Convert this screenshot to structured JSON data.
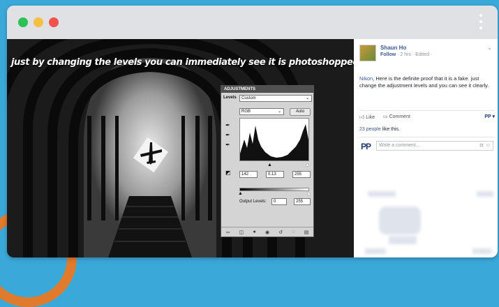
{
  "window": {
    "controls": [
      "close-dot",
      "minimize-dot",
      "maximize-dot"
    ],
    "colors": {
      "green": "#2bc157",
      "yellow": "#f5c042",
      "red": "#f2544c",
      "titlebar": "#dfe1e5"
    }
  },
  "photo": {
    "caption": "just by changing the levels you can immediately see it is photoshopped"
  },
  "adjustments": {
    "title": "ADJUSTMENTS",
    "preset_label": "Levels",
    "preset_value": "Custom",
    "channel": "RGB",
    "auto_label": "Auto",
    "input_black": "142",
    "input_gamma": "0.13",
    "input_white": "255",
    "output_label": "Output Levels:",
    "output_black": "0",
    "output_white": "255"
  },
  "facebook": {
    "author": "Shaun Ho",
    "follow": "Follow",
    "time": "· 2 hrs · Edited ·",
    "chevron": "⌄",
    "post_mention": "Nikon",
    "post_text": ", Here is the definite proof that it is a fake. just change the adjustment levels and you can see it clearly.",
    "like_label": "Like",
    "comment_label": "Comment",
    "reactor_badge": "PP ▾",
    "likes_count": "23 people",
    "likes_suffix": " like this.",
    "commenter_initials": "PP",
    "comment_placeholder": "Write a comment...",
    "link_color": "#3b5998"
  }
}
